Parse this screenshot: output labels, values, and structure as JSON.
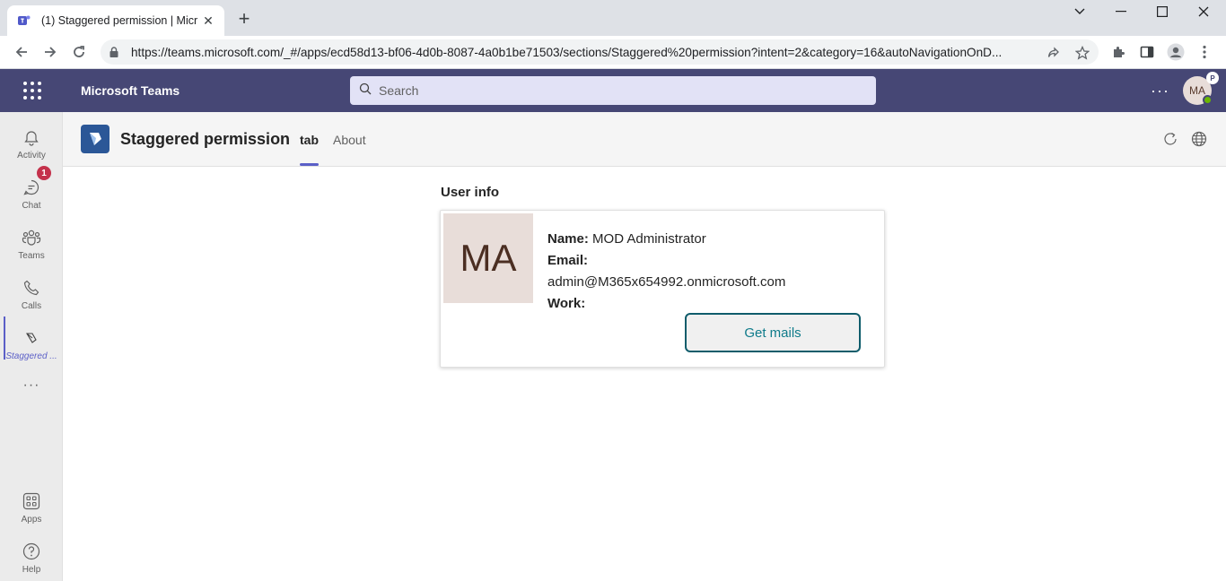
{
  "browser": {
    "tab_title": "(1) Staggered permission | Micro",
    "close_symbol": "✕",
    "new_tab_symbol": "+",
    "url": "https://teams.microsoft.com/_#/apps/ecd58d13-bf06-4d0b-8087-4a0b1be71503/sections/Staggered%20permission?intent=2&category=16&autoNavigationOnD..."
  },
  "teams": {
    "title": "Microsoft Teams",
    "search_placeholder": "Search",
    "more_label": "···",
    "avatar_initials": "MA",
    "avatar_badge": "P"
  },
  "rail": {
    "items": [
      {
        "label": "Activity",
        "icon": "bell-icon"
      },
      {
        "label": "Chat",
        "icon": "chat-icon",
        "badge": "1"
      },
      {
        "label": "Teams",
        "icon": "teams-icon"
      },
      {
        "label": "Calls",
        "icon": "phone-icon"
      },
      {
        "label": "Staggered ...",
        "icon": "app-icon",
        "active": true
      },
      {
        "label": "Apps",
        "icon": "apps-icon"
      },
      {
        "label": "Help",
        "icon": "help-icon"
      }
    ],
    "more_label": "···"
  },
  "app": {
    "title": "Staggered permission",
    "tabs": [
      {
        "label": "tab",
        "active": true
      },
      {
        "label": "About",
        "active": false
      }
    ]
  },
  "content": {
    "section_title": "User info",
    "card": {
      "initials": "MA",
      "name_label": "Name:",
      "name_value": " MOD Administrator",
      "email_label": "Email:",
      "email_value": "admin@M365x654992.onmicrosoft.com",
      "work_label": "Work:",
      "button_label": "Get mails"
    }
  },
  "colors": {
    "teams_header": "#464775",
    "accent": "#5b5fc7",
    "button_border": "#0f5c6b",
    "chat_badge": "#c4314b"
  }
}
